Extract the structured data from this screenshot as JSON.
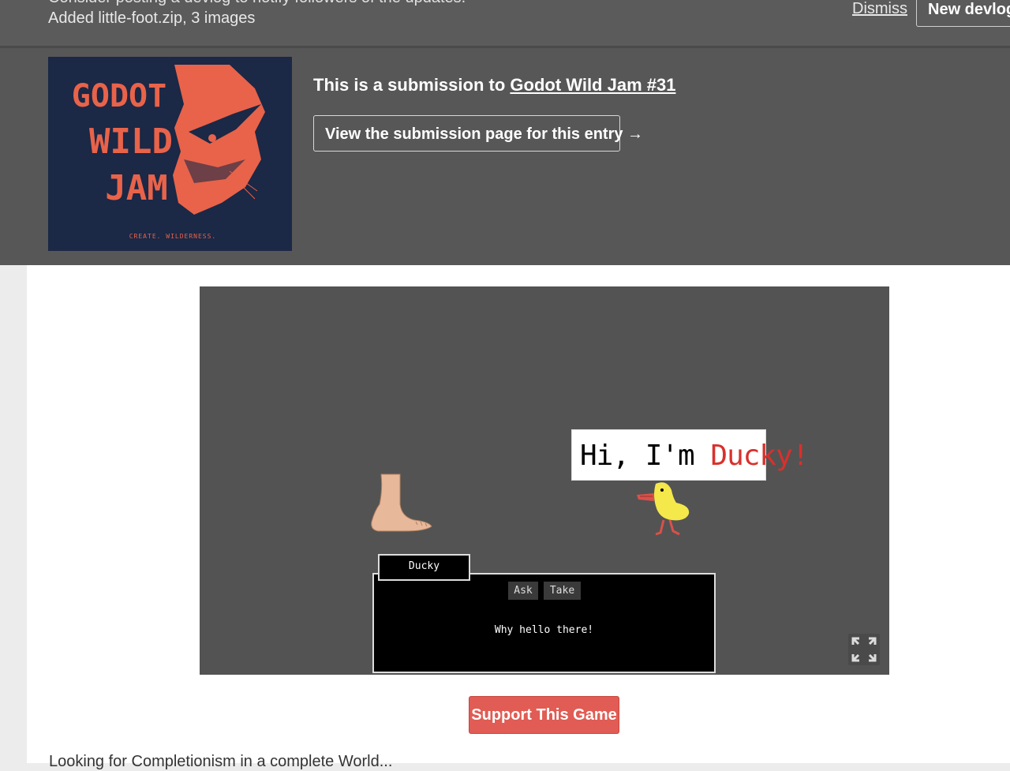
{
  "notice": {
    "line1": "Consider posting a devlog to notify followers of the updates.",
    "line2": "Added little-foot.zip, 3 images",
    "dismiss": "Dismiss",
    "new_devlog": "New devlog"
  },
  "jam": {
    "logo_lines": [
      "GODOT",
      "WILD",
      "JAM"
    ],
    "logo_tagline": "CREATE. WILDERNESS.",
    "title_prefix": "This is a submission to ",
    "title_link": "Godot Wild Jam #31",
    "button_label": "View the submission page for this entry →"
  },
  "game": {
    "speech_prefix": "Hi, I'm ",
    "speech_name": "Ducky!",
    "speaker": "Ducky",
    "choices": [
      "Ask",
      "Take"
    ],
    "dialog": "Why hello there!"
  },
  "support_label": "Support This Game",
  "bottom_text": "Looking for Completionism in a complete World..."
}
